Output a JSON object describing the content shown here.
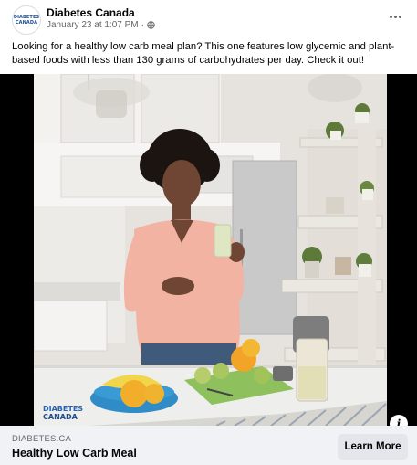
{
  "header": {
    "avatar_line1": "DIABETES",
    "avatar_line2": "CANADA",
    "page_name": "Diabetes Canada",
    "timestamp": "January 23 at 1:07 PM",
    "separator": "·",
    "privacy_icon": "globe-icon",
    "more_icon": "more-options-icon"
  },
  "post": {
    "text": "Looking for a healthy low carb meal plan? This one features low glycemic and plant-based foods with less than 130 grams of carbohydrates per day. Check it out!"
  },
  "image": {
    "watermark_line1": "DIABETES",
    "watermark_line2": "CANADA",
    "info_icon": "info-icon"
  },
  "link_preview": {
    "domain": "DIABETES.CA",
    "headline": "Healthy Low Carb Meal",
    "cta_label": "Learn More"
  },
  "colors": {
    "brand_blue": "#1d4f91",
    "secondary_text": "#65676b",
    "caption_bg": "#f0f2f5",
    "button_bg": "#e4e6eb"
  }
}
